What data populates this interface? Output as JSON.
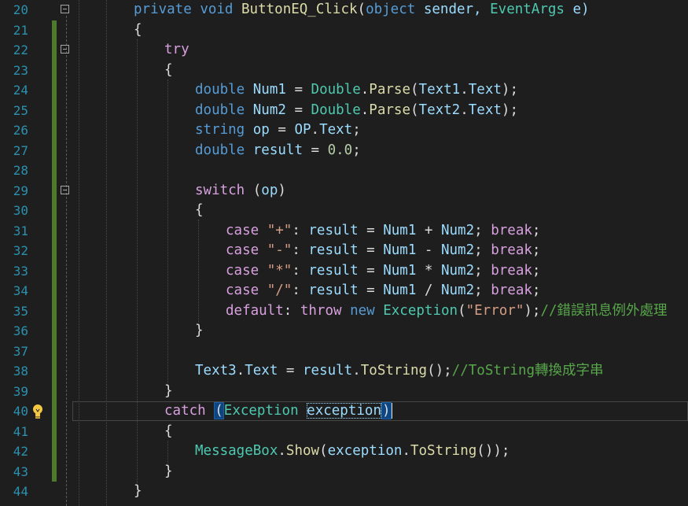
{
  "editor": {
    "line_numbers": [
      "20",
      "21",
      "22",
      "23",
      "24",
      "25",
      "26",
      "27",
      "28",
      "29",
      "30",
      "31",
      "32",
      "33",
      "34",
      "35",
      "36",
      "37",
      "38",
      "39",
      "40",
      "41",
      "42",
      "43",
      "44"
    ],
    "lines": {
      "l20": [
        "private",
        "void",
        "ButtonEQ_Click",
        "(",
        "object",
        " sender, ",
        "EventArgs",
        " e)"
      ],
      "l21": [
        "{"
      ],
      "l22": [
        "try"
      ],
      "l23": [
        "{"
      ],
      "l24": [
        "double",
        " ",
        "Num1",
        " = ",
        "Double",
        ".",
        "Parse",
        "(",
        "Text1",
        ".",
        "Text",
        ");"
      ],
      "l25": [
        "double",
        " ",
        "Num2",
        " = ",
        "Double",
        ".",
        "Parse",
        "(",
        "Text2",
        ".",
        "Text",
        ");"
      ],
      "l26": [
        "string",
        " ",
        "op",
        " = ",
        "OP",
        ".",
        "Text",
        ";"
      ],
      "l27": [
        "double",
        " ",
        "result",
        " = ",
        "0.0",
        ";"
      ],
      "l29": [
        "switch",
        " (",
        "op",
        ")"
      ],
      "l30": [
        "{"
      ],
      "l31": [
        "case",
        " ",
        "\"+\"",
        ": ",
        "result",
        " = ",
        "Num1",
        " + ",
        "Num2",
        "; ",
        "break",
        ";"
      ],
      "l32": [
        "case",
        " ",
        "\"-\"",
        ": ",
        "result",
        " = ",
        "Num1",
        " - ",
        "Num2",
        "; ",
        "break",
        ";"
      ],
      "l33": [
        "case",
        " ",
        "\"*\"",
        ": ",
        "result",
        " = ",
        "Num1",
        " * ",
        "Num2",
        "; ",
        "break",
        ";"
      ],
      "l34": [
        "case",
        " ",
        "\"/\"",
        ": ",
        "result",
        " = ",
        "Num1",
        " / ",
        "Num2",
        "; ",
        "break",
        ";"
      ],
      "l35": [
        "default",
        ": ",
        "throw",
        " ",
        "new",
        " ",
        "Exception",
        "(",
        "\"Error\"",
        ");",
        "//錯誤訊息例外處理"
      ],
      "l36": [
        "}"
      ],
      "l38": [
        "Text3",
        ".",
        "Text",
        " = ",
        "result",
        ".",
        "ToString",
        "();",
        "//ToString轉換成字串"
      ],
      "l39": [
        "}"
      ],
      "l40": [
        "catch",
        " ",
        "(",
        "Exception",
        " ",
        "exception",
        ")"
      ],
      "l41": [
        "{"
      ],
      "l42": [
        "MessageBox",
        ".",
        "Show",
        "(",
        "exception",
        ".",
        "ToString",
        "());"
      ],
      "l43": [
        "}"
      ],
      "l44": [
        "}"
      ]
    },
    "colors": {
      "background": "#1e1e1e",
      "line_number": "#2b91af",
      "keyword": "#569cd6",
      "control_keyword": "#d8a0df",
      "type": "#4ec9b0",
      "variable": "#9cdcfe",
      "method": "#dcdcaa",
      "string": "#d69d85",
      "number": "#b5cea8",
      "comment": "#57a64a",
      "change_bar": "#4e7a2d"
    },
    "icons": [
      "collapse-icon",
      "lightbulb-icon"
    ]
  }
}
